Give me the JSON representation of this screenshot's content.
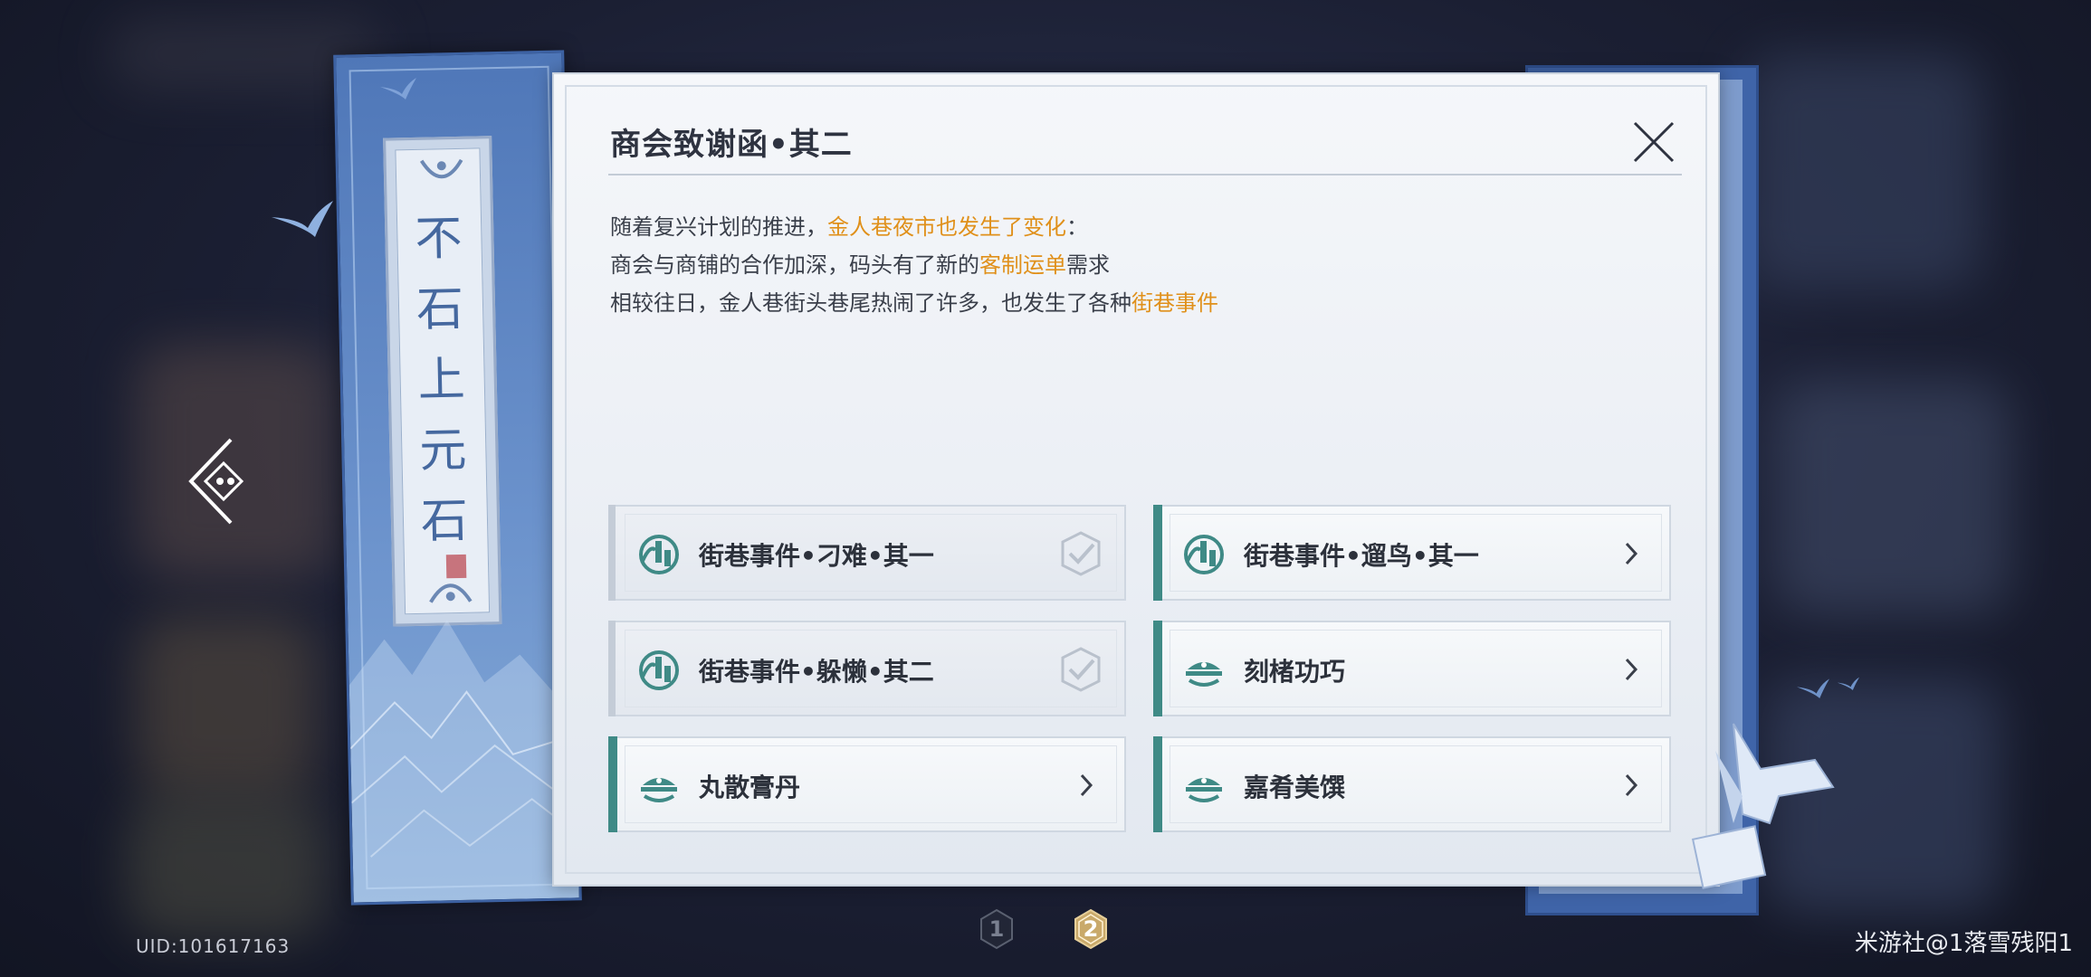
{
  "letter": {
    "title": "商会致谢函•其二",
    "paragraph": [
      {
        "before": "随着复兴计划的推进，",
        "highlight": "金人巷夜市也发生了变化",
        "after": "："
      },
      {
        "before": "商会与商铺的合作加深，码头有了新的",
        "highlight": "客制运单",
        "after": "需求"
      },
      {
        "before": "相较往日，金人巷街头巷尾热闹了许多，也发生了各种",
        "highlight": "街巷事件",
        "after": ""
      }
    ],
    "highlight_color": "#e0901a"
  },
  "banner": {
    "glyphs": "不石上元石"
  },
  "events": [
    {
      "label": "街巷事件•刁难•其一",
      "icon": "lantern-hand-icon",
      "status": "completed"
    },
    {
      "label": "街巷事件•遛鸟•其一",
      "icon": "lantern-hand-icon",
      "status": "available"
    },
    {
      "label": "街巷事件•躲懒•其二",
      "icon": "lantern-hand-icon",
      "status": "completed"
    },
    {
      "label": "刻楮功巧",
      "icon": "boat-cloud-icon",
      "status": "available"
    },
    {
      "label": "丸散膏丹",
      "icon": "boat-cloud-icon",
      "status": "available"
    },
    {
      "label": "嘉肴美馔",
      "icon": "boat-cloud-icon",
      "status": "available"
    }
  ],
  "pagination": {
    "pages": [
      "1",
      "2"
    ],
    "current": "2"
  },
  "footer": {
    "uid": "UID:101617163",
    "watermark": "米游社@1落雪残阳1"
  },
  "colors": {
    "accent_teal": "#3f8a86",
    "banner_blue": "#4f77b8",
    "page_active_gold": "#c9a96a"
  }
}
